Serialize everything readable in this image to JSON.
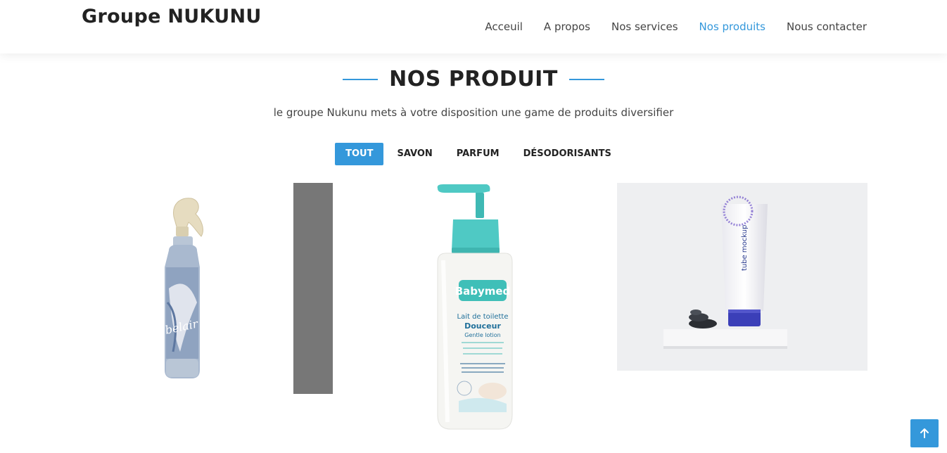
{
  "header": {
    "logo": "Groupe NUKUNU",
    "nav": [
      {
        "label": "Acceuil"
      },
      {
        "label": "A propos"
      },
      {
        "label": "Nos services"
      },
      {
        "label": "Nos produits",
        "active": true
      },
      {
        "label": "Nous contacter"
      }
    ]
  },
  "section": {
    "title": "NOS PRODUIT",
    "subtitle": "le groupe Nukunu mets à votre disposition une game de produits diversifier"
  },
  "filters": [
    {
      "label": "TOUT",
      "active": true
    },
    {
      "label": "SAVON"
    },
    {
      "label": "PARFUM"
    },
    {
      "label": "DÉSODORISANTS"
    }
  ],
  "products": [
    {
      "image": "spray-bottle-image",
      "brand_text": "belair"
    },
    {
      "image": "lotion-pump-bottle-image",
      "brand_text": "Babymed",
      "line1": "Lait de toilette",
      "line2": "Douceur",
      "line3": "Gentle lotion"
    },
    {
      "image": "cosmetic-tube-image",
      "tube_text": "tube mockup"
    }
  ],
  "colors": {
    "accent": "#3498db",
    "text": "#222222"
  },
  "icons": {
    "back_to_top": "arrow-up-icon"
  }
}
